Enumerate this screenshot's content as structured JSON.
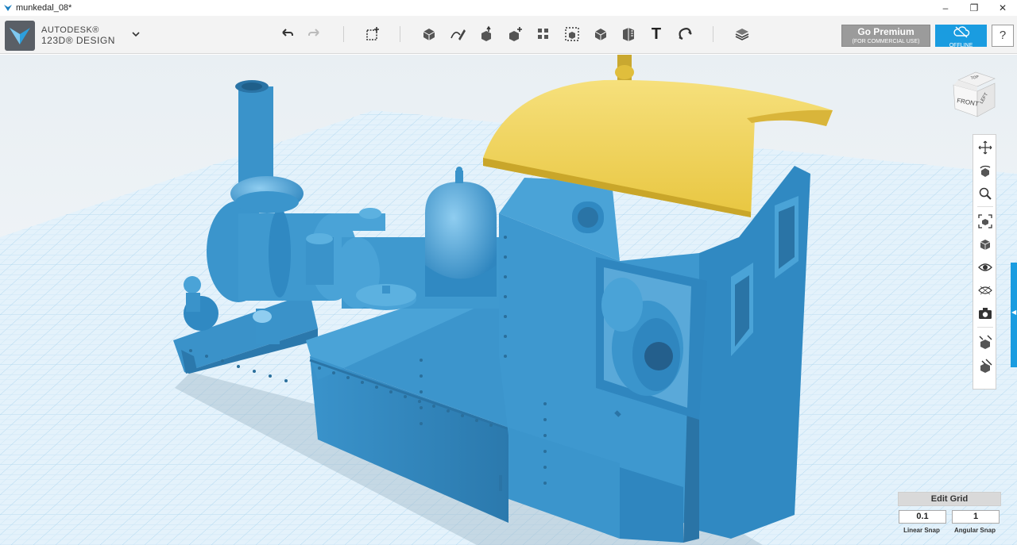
{
  "window": {
    "title": "munkedal_08*",
    "minimize_glyph": "–",
    "maximize_glyph": "❐",
    "close_glyph": "✕"
  },
  "brand": {
    "line1": "AUTODESK®",
    "line2": "123D® DESIGN",
    "logo_icon": "autodesk-logo-icon",
    "menu_icon": "chevron-down-icon"
  },
  "toolbar": {
    "tools": [
      {
        "name": "undo-icon"
      },
      {
        "name": "redo-icon"
      },
      {
        "name": "transform-icon"
      },
      {
        "name": "primitives-icon"
      },
      {
        "name": "sketch-icon"
      },
      {
        "name": "construct-icon"
      },
      {
        "name": "modify-icon"
      },
      {
        "name": "pattern-icon"
      },
      {
        "name": "grouping-icon"
      },
      {
        "name": "combine-icon"
      },
      {
        "name": "measure-icon"
      },
      {
        "name": "text-icon"
      },
      {
        "name": "snap-icon"
      },
      {
        "name": "material-icon"
      }
    ],
    "text_tool_glyph": "T"
  },
  "premium": {
    "label": "Go Premium",
    "sublabel": "(FOR COMMERCIAL USE)"
  },
  "offline": {
    "label": "OFFLINE",
    "icon": "cloud-offline-icon"
  },
  "help": {
    "label": "?"
  },
  "viewcube": {
    "top": "TOP",
    "front": "FRONT",
    "right": "LEFT"
  },
  "navbar": {
    "items": [
      {
        "name": "pan-icon"
      },
      {
        "name": "orbit-icon"
      },
      {
        "name": "zoom-icon"
      },
      {
        "name": "fit-icon"
      },
      {
        "name": "views-icon"
      },
      {
        "name": "visibility-icon"
      },
      {
        "name": "materials-outline-icon"
      },
      {
        "name": "screenshot-icon"
      },
      {
        "name": "selection-filter-icon"
      },
      {
        "name": "selection-mode-icon"
      }
    ]
  },
  "edit_grid": {
    "title": "Edit Grid",
    "linear_value": "0.1",
    "angular_value": "1",
    "linear_label": "Linear Snap",
    "angular_label": "Angular Snap"
  },
  "colors": {
    "model_blue": "#3d98cf",
    "model_blue_dark": "#2a74a6",
    "roof_yellow": "#f0d35a",
    "accent": "#1a9ce0",
    "grid_line": "#a9d3ee"
  }
}
